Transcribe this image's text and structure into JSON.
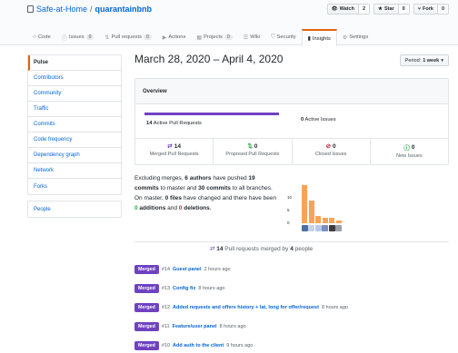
{
  "repo": {
    "owner": "Safe-at-Home",
    "separator": "/",
    "name": "quarantainbnb"
  },
  "actions": [
    {
      "label": "Watch",
      "count": "2",
      "icon": "eye-icon",
      "glyph": "👁"
    },
    {
      "label": "Star",
      "count": "0",
      "icon": "star-icon",
      "glyph": "★"
    },
    {
      "label": "Fork",
      "count": "0",
      "icon": "fork-icon",
      "glyph": "⑂"
    }
  ],
  "tabs": [
    {
      "label": "Code",
      "icon": "code-icon",
      "glyph": "‹›",
      "count": ""
    },
    {
      "label": "Issues",
      "icon": "issue-icon",
      "glyph": "ⓘ",
      "count": "0"
    },
    {
      "label": "Pull requests",
      "icon": "pull-request-icon",
      "glyph": "⇅",
      "count": "0"
    },
    {
      "label": "Actions",
      "icon": "actions-icon",
      "glyph": "▶",
      "count": ""
    },
    {
      "label": "Projects",
      "icon": "project-icon",
      "glyph": "▦",
      "count": "0"
    },
    {
      "label": "Wiki",
      "icon": "book-icon",
      "glyph": "☰",
      "count": ""
    },
    {
      "label": "Security",
      "icon": "shield-icon",
      "glyph": "⛉",
      "count": ""
    },
    {
      "label": "Insights",
      "icon": "graph-icon",
      "glyph": "▮",
      "count": "",
      "active": true
    },
    {
      "label": "Settings",
      "icon": "gear-icon",
      "glyph": "⚙",
      "count": ""
    }
  ],
  "sidebar": {
    "items": [
      "Pulse",
      "Contributors",
      "Community",
      "Traffic",
      "Commits",
      "Code frequency",
      "Dependency graph",
      "Network",
      "Forks"
    ],
    "selected": "Pulse",
    "extra": [
      "People"
    ]
  },
  "main": {
    "title": "March 28, 2020 – April 4, 2020",
    "period_label": "Period:",
    "period_value": "1 week"
  },
  "overview": {
    "heading": "Overview",
    "active_prs": "14",
    "active_prs_text": "Active Pull Requests",
    "active_issues": "0",
    "active_issues_text": "Active Issues",
    "stats": [
      {
        "value": "14",
        "label": "Merged Pull Requests",
        "color": "#6f42c1",
        "icon": "merge-icon",
        "glyph": "⇄"
      },
      {
        "value": "0",
        "label": "Proposed Pull Requests",
        "color": "#28a745",
        "icon": "pull-request-icon",
        "glyph": "⇅"
      },
      {
        "value": "0",
        "label": "Closed Issues",
        "color": "#cb2431",
        "icon": "issue-closed-icon",
        "glyph": "⊘"
      },
      {
        "value": "0",
        "label": "New Issues",
        "color": "#28a745",
        "icon": "issue-opened-icon",
        "glyph": "ⓘ"
      }
    ]
  },
  "summary": {
    "t1": "Excluding merges, ",
    "authors": "6 authors",
    "t2": " have pushed ",
    "commits_master": "19 commits",
    "t3": " to master and ",
    "commits_all": "30 commits",
    "t4": " to all branches. On master, ",
    "files": "0 files",
    "t5": " have changed and there have been ",
    "additions": "0",
    "t6": " additions",
    "t7": " and ",
    "deletions": "0",
    "t8": " deletions",
    "t9": "."
  },
  "chart_data": {
    "type": "bar",
    "yticks": [
      "10",
      "5",
      "0"
    ],
    "values": [
      15,
      9,
      3,
      2,
      2,
      1
    ],
    "ylim": [
      0,
      17
    ],
    "bar_color": "#f9a35a"
  },
  "merged": {
    "prefix": "",
    "count": "14",
    "mid": " Pull requests merged by ",
    "people": "4",
    "suffix": " people"
  },
  "prs": [
    {
      "badge": "Merged",
      "num": "#14",
      "title": "Guest panel",
      "time": "2 hours ago"
    },
    {
      "badge": "Merged",
      "num": "#13",
      "title": "Config fix",
      "time": "8 hours ago"
    },
    {
      "badge": "Merged",
      "num": "#12",
      "title": "Added requests and offers history + lat, long for offer/request",
      "time": "8 hours ago"
    },
    {
      "badge": "Merged",
      "num": "#11",
      "title": "Feature/user panel",
      "time": "8 hours ago"
    },
    {
      "badge": "Merged",
      "num": "#10",
      "title": "Add auth to the client",
      "time": "9 hours ago"
    }
  ]
}
